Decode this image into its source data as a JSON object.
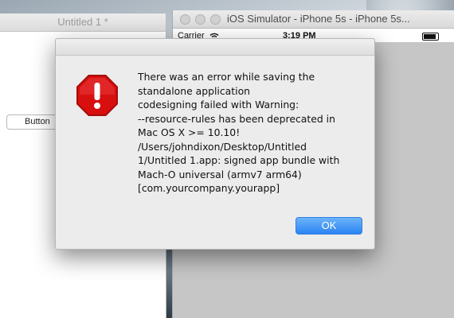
{
  "document_window": {
    "title": "Untitled 1 *",
    "button_label": "Button"
  },
  "simulator_window": {
    "title": "iOS Simulator - iPhone 5s - iPhone 5s...",
    "status": {
      "carrier": "Carrier",
      "time": "3:19 PM"
    }
  },
  "alert": {
    "message": "There was an error while saving the\nstandalone application\ncodesigning failed with Warning:\n--resource-rules has been deprecated in\nMac OS X >= 10.10!\n/Users/johndixon/Desktop/Untitled\n1/Untitled 1.app: signed app bundle with\nMach-O universal (armv7 arm64)\n[com.yourcompany.yourapp]",
    "ok_label": "OK",
    "icon": "error-stop-icon",
    "icon_color": "#d70f0f"
  },
  "colors": {
    "accent": "#2a84f2"
  }
}
